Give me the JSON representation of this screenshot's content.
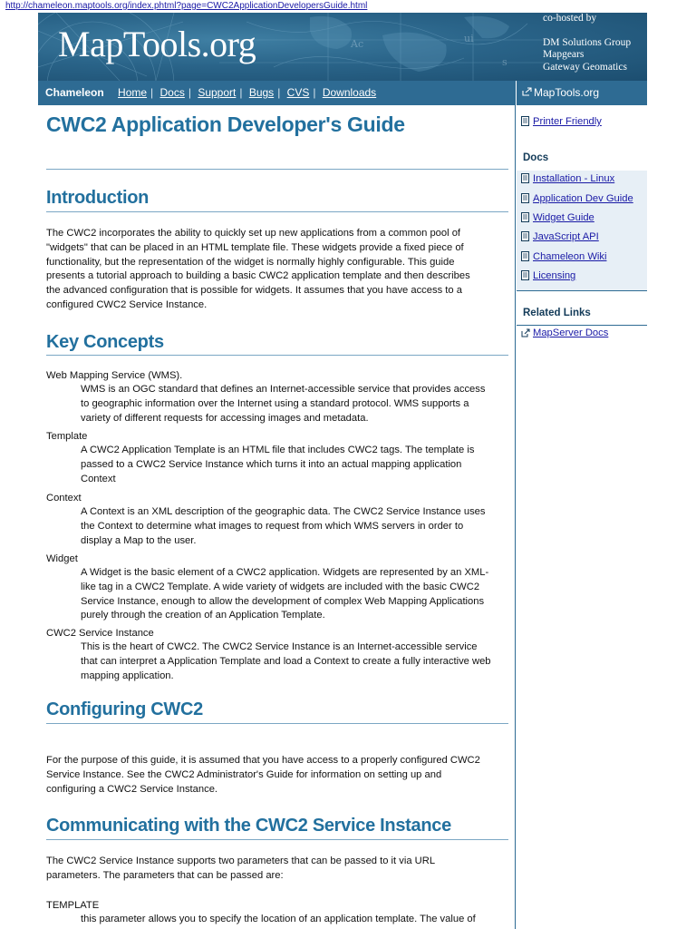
{
  "url": "http://chameleon.maptools.org/index.phtml?page=CWC2ApplicationDevelopersGuide.html",
  "banner": {
    "logo": "MapTools.org",
    "cohosted_label": "co-hosted by",
    "partners": [
      "DM Solutions Group",
      "Mapgears",
      "Gateway Geomatics"
    ]
  },
  "nav": {
    "brand": "Chameleon",
    "links": [
      "Home",
      "Docs",
      "Support",
      "Bugs",
      "CVS",
      "Downloads"
    ],
    "separator": "|",
    "site_link": "MapTools.org"
  },
  "page": {
    "title": "CWC2 Application Developer's Guide",
    "intro_heading": "Introduction",
    "intro_lines": [
      "The CWC2 incorporates the ability to quickly set up new applications from a common pool of",
      "\"widgets\" that can be placed in an HTML template file. These widgets provide a fixed piece of",
      "functionality, but the representation of the widget is normally highly configurable. This guide",
      "presents a tutorial approach to building a basic CWC2 application template and then describes",
      "the advanced configuration that is possible for widgets. It assumes that you have access to a",
      "configured CWC2 Service Instance."
    ],
    "key_heading": "Key Concepts",
    "concepts": [
      {
        "term": "Web Mapping Service (WMS).",
        "lines": [
          "WMS is an OGC standard that defines an Internet-accessible service that provides access",
          "to geographic information over the Internet using a standard protocol. WMS supports a",
          "variety of different requests for accessing images and metadata."
        ]
      },
      {
        "term": "Template",
        "lines": [
          "A CWC2 Application Template is an HTML file that includes CWC2 tags. The template is",
          "passed to a CWC2 Service Instance which turns it into an actual mapping application",
          "Context"
        ]
      },
      {
        "term": "Context",
        "lines": [
          "A Context is an XML description of the geographic data. The CWC2 Service Instance uses",
          "the Context to determine what images to request from which WMS servers in order to",
          "display a Map to the user."
        ]
      },
      {
        "term": "Widget",
        "lines": [
          "A Widget is the basic element of a CWC2 application. Widgets are represented by an XML-",
          "like tag in a CWC2 Template. A wide variety of widgets are included with the basic CWC2",
          "Service Instance, enough to allow the development of complex Web Mapping Applications",
          "purely through the creation of an Application Template."
        ]
      },
      {
        "term": "CWC2 Service Instance",
        "lines": [
          "This is the heart of CWC2. The CWC2 Service Instance is an Internet-accessible service",
          "that can interpret a Application Template and load a Context to create a fully interactive web",
          "mapping application."
        ]
      }
    ],
    "config_heading": "Configuring CWC2",
    "config_lines": [
      "For the purpose of this guide, it is assumed that you have access to a properly configured CWC2",
      "Service Instance. See the CWC2 Administrator's Guide for information on setting up and",
      "configuring a CWC2 Service Instance."
    ],
    "comm_heading": "Communicating with the CWC2 Service Instance",
    "comm_lines": [
      "The CWC2 Service Instance supports two parameters that can be passed to it via URL",
      "parameters. The parameters that can be passed are:"
    ],
    "param_term": "TEMPLATE",
    "param_line": "this parameter allows you to specify the location of an application template. The value of"
  },
  "sidebar": {
    "printer": "Printer Friendly",
    "docs_heading": "Docs",
    "docs": [
      "Installation - Linux",
      "Application Dev Guide",
      "Widget Guide",
      "JavaScript API",
      "Chameleon Wiki",
      "Licensing"
    ],
    "related_heading": "Related Links",
    "related": [
      "MapServer Docs"
    ]
  }
}
